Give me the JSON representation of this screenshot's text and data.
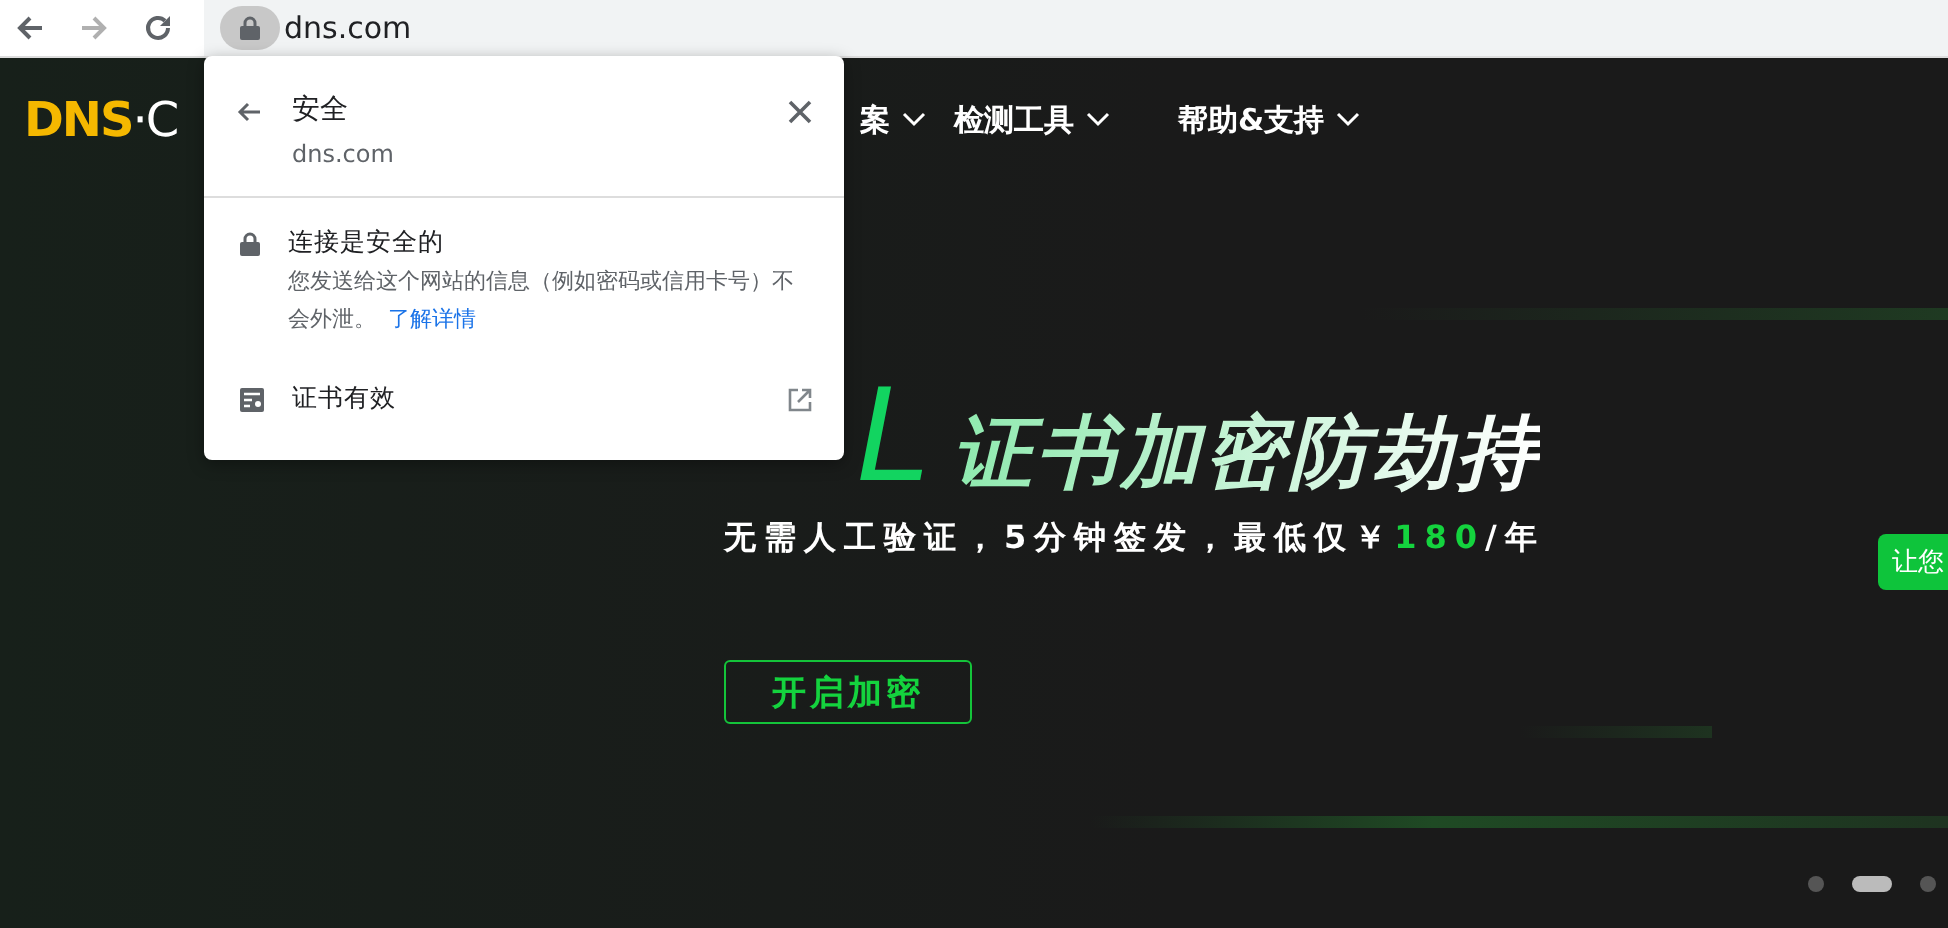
{
  "browser": {
    "address": "dns.com"
  },
  "site": {
    "logo": {
      "brand": "DNS",
      "suffix": "·C"
    },
    "nav": [
      {
        "label": "案"
      },
      {
        "label": "检测工具"
      },
      {
        "label": "帮助&支持"
      }
    ],
    "hero": {
      "title_big": "L",
      "title": "证书加密防劫持",
      "subtitle_prefix": "无需人工验证，5分钟签发，最低仅￥",
      "price": "180",
      "subtitle_suffix": "/年",
      "button": "开启加密"
    },
    "side_badge": "让您",
    "carousel": [
      {
        "selected": false
      },
      {
        "selected": true
      },
      {
        "selected": false
      }
    ]
  },
  "popup": {
    "title": "安全",
    "domain": "dns.com",
    "connection_title": "连接是安全的",
    "connection_text": "您发送给这个网站的信息（例如密码或信用卡号）不会外泄。",
    "learn_more": "了解详情",
    "certificate": "证书有效"
  }
}
